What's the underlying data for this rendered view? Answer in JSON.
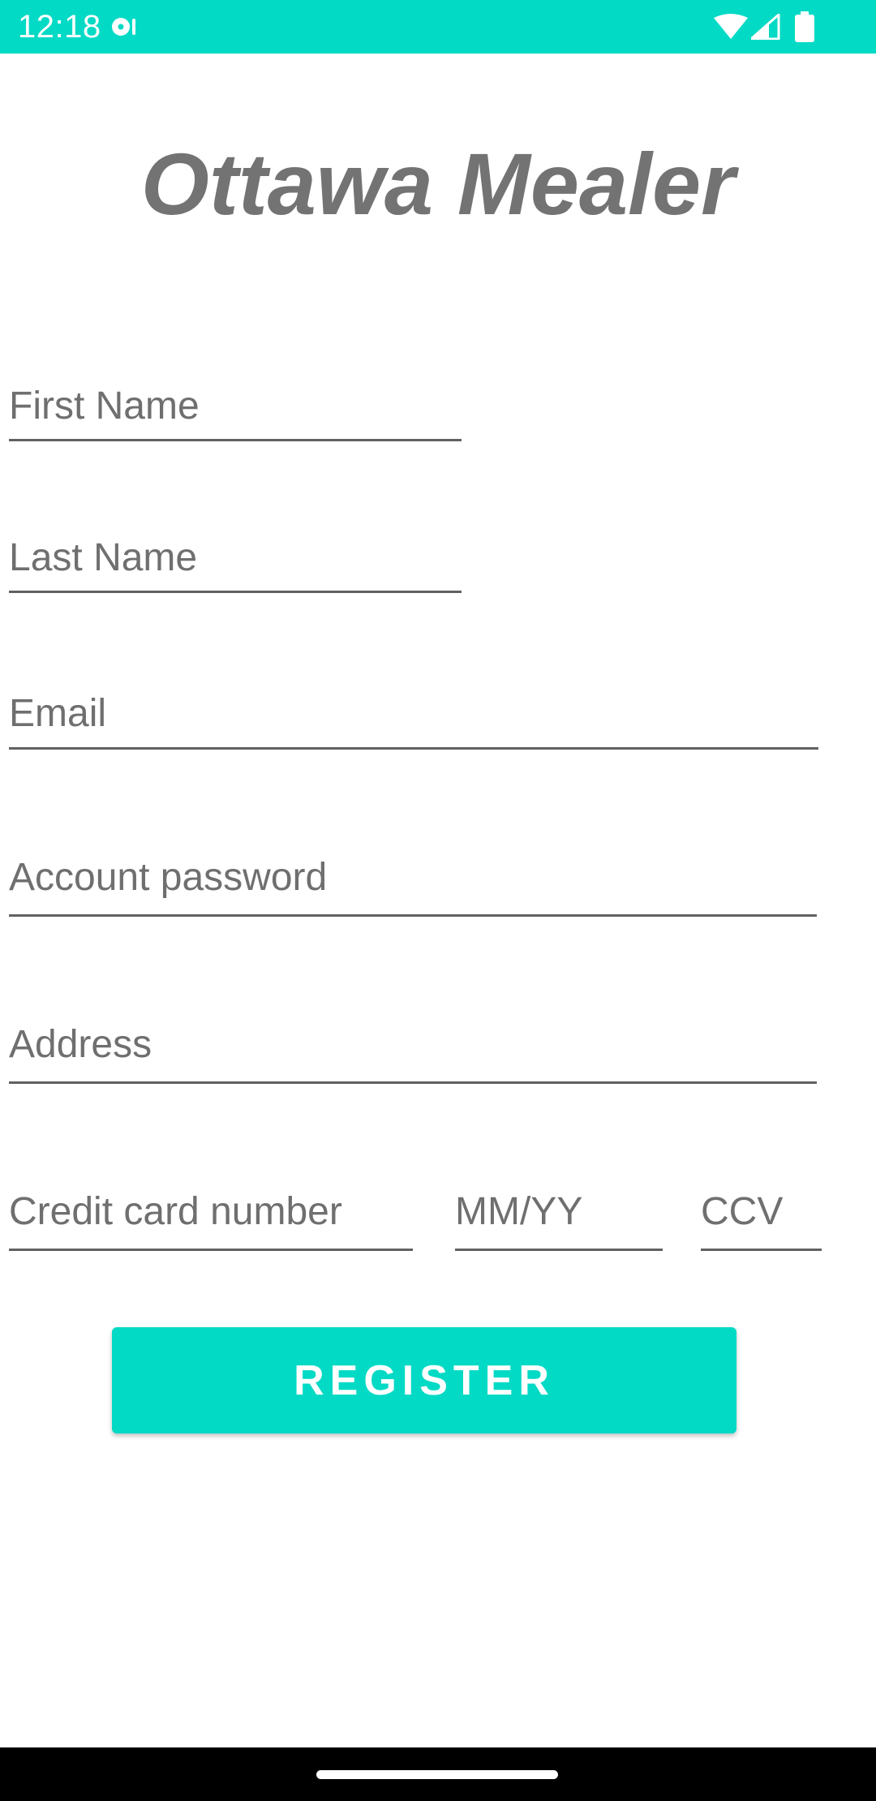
{
  "status_bar": {
    "time": "12:18",
    "background_color": "#03dac5",
    "icons": [
      "notification-icon",
      "wifi-icon",
      "cell-signal-icon",
      "battery-icon"
    ]
  },
  "app": {
    "title": "Ottawa Mealer",
    "title_color": "#737373"
  },
  "form": {
    "first_name": {
      "placeholder": "First Name",
      "value": ""
    },
    "last_name": {
      "placeholder": "Last Name",
      "value": ""
    },
    "email": {
      "placeholder": "Email",
      "value": ""
    },
    "password": {
      "placeholder": "Account password",
      "value": ""
    },
    "address": {
      "placeholder": "Address",
      "value": ""
    },
    "card_number": {
      "placeholder": "Credit card number",
      "value": ""
    },
    "expiry": {
      "placeholder": "MM/YY",
      "value": ""
    },
    "ccv": {
      "placeholder": "CCV",
      "value": ""
    }
  },
  "register_button": {
    "label": "REGISTER",
    "color": "#03dac5"
  },
  "nav_bar": {
    "icons": [
      "home-handle"
    ]
  }
}
